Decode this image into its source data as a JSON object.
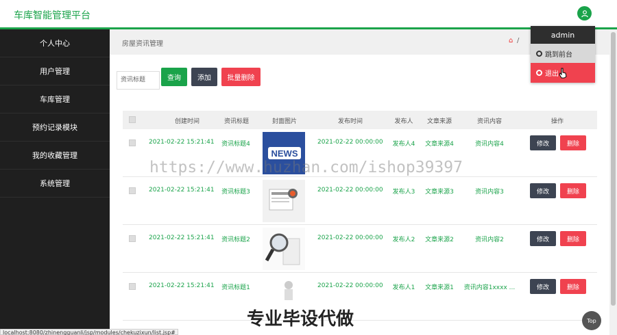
{
  "header": {
    "brand": "车库智能管理平台",
    "user_icon": "user-icon"
  },
  "sidebar": {
    "items": [
      {
        "label": "个人中心"
      },
      {
        "label": "用户管理"
      },
      {
        "label": "车库管理"
      },
      {
        "label": "预约记录模块"
      },
      {
        "label": "我的收藏管理"
      },
      {
        "label": "系统管理"
      }
    ]
  },
  "breadcrumb": {
    "title": "房屋资讯管理",
    "home_icon": "home-icon",
    "separator": "/"
  },
  "toolbar": {
    "search_placeholder": "资讯标题",
    "query_label": "查询",
    "add_label": "添加",
    "batch_delete_label": "批量删除"
  },
  "table": {
    "columns": [
      "创建时间",
      "资讯标题",
      "封面图片",
      "发布时间",
      "发布人",
      "文章来源",
      "资讯内容",
      "操作"
    ],
    "rows": [
      {
        "created": "2021-02-22 15:21:41",
        "title": "资讯标题4",
        "published": "2021-02-22 00:00:00",
        "author": "发布人4",
        "source": "文章来源4",
        "content": "资讯内容4",
        "edit": "修改",
        "delete": "删除"
      },
      {
        "created": "2021-02-22 15:21:41",
        "title": "资讯标题3",
        "published": "2021-02-22 00:00:00",
        "author": "发布人3",
        "source": "文章来源3",
        "content": "资讯内容3",
        "edit": "修改",
        "delete": "删除"
      },
      {
        "created": "2021-02-22 15:21:41",
        "title": "资讯标题2",
        "published": "2021-02-22 00:00:00",
        "author": "发布人2",
        "source": "文章来源2",
        "content": "资讯内容2",
        "edit": "修改",
        "delete": "删除"
      },
      {
        "created": "2021-02-22 15:21:41",
        "title": "资讯标题1",
        "published": "2021-02-22 00:00:00",
        "author": "发布人1",
        "source": "文章来源1",
        "content": "资讯内容1xxxx ...",
        "edit": "修改",
        "delete": "删除"
      }
    ]
  },
  "dropdown": {
    "username": "admin",
    "front_label": "跳到前台",
    "logout_label": "退出"
  },
  "overlay": {
    "watermark_url": "https://www.huzhan.com/ishop39397",
    "watermark_cn": "专业毕设代做",
    "status_url": "localhost:8080/zhinengguanli/jsp/modules/chekuzixun/list.jsp#",
    "top_label": "Top"
  },
  "colors": {
    "accent": "#1aa34a",
    "danger": "#f0424f",
    "dark": "#3d4452",
    "sidebar": "#1f1f1f"
  }
}
